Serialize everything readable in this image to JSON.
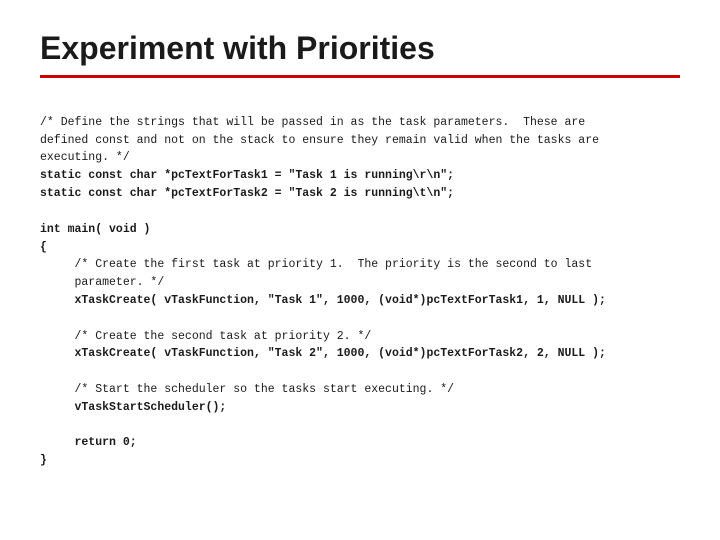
{
  "slide": {
    "title": "Experiment with Priorities",
    "accent_color": "#cc0000",
    "code": {
      "lines": [
        {
          "type": "comment",
          "text": "/* Define the strings that will be passed in as the task parameters.  These are"
        },
        {
          "type": "comment",
          "text": "defined const and not on the stack to ensure they remain valid when the tasks are"
        },
        {
          "type": "comment",
          "text": "executing. */"
        },
        {
          "type": "bold",
          "text": "static const char *pcTextForTask1 = \"Task 1 is running\\r\\n\";"
        },
        {
          "type": "bold",
          "text": "static const char *pcTextForTask2 = \"Task 2 is running\\t\\n\";"
        },
        {
          "type": "normal",
          "text": ""
        },
        {
          "type": "bold",
          "text": "int main( void )"
        },
        {
          "type": "bold",
          "text": "{"
        },
        {
          "type": "comment",
          "text": "     /* Create the first task at priority 1.  The priority is the second to last"
        },
        {
          "type": "comment",
          "text": "     parameter. */"
        },
        {
          "type": "bold",
          "text": "     xTaskCreate( vTaskFunction, \"Task 1\", 1000, (void*)pcTextForTask1, 1, NULL );"
        },
        {
          "type": "normal",
          "text": ""
        },
        {
          "type": "comment",
          "text": "     /* Create the second task at priority 2. */"
        },
        {
          "type": "bold",
          "text": "     xTaskCreate( vTaskFunction, \"Task 2\", 1000, (void*)pcTextForTask2, 2, NULL );"
        },
        {
          "type": "normal",
          "text": ""
        },
        {
          "type": "comment",
          "text": "     /* Start the scheduler so the tasks start executing. */"
        },
        {
          "type": "bold",
          "text": "     vTaskStartScheduler();"
        },
        {
          "type": "normal",
          "text": ""
        },
        {
          "type": "bold",
          "text": "     return 0;"
        },
        {
          "type": "bold",
          "text": "}"
        }
      ]
    }
  }
}
